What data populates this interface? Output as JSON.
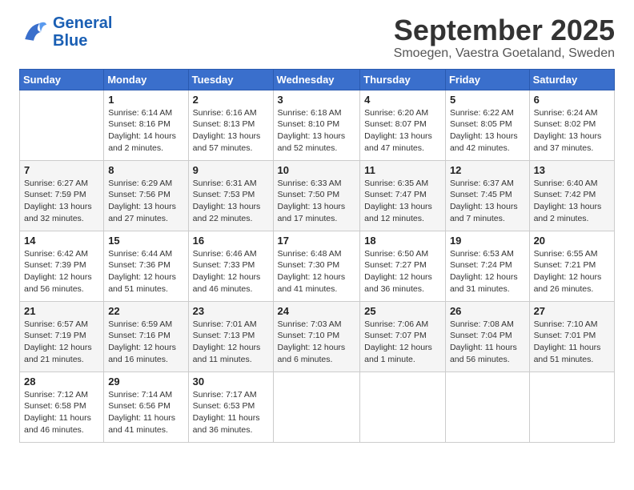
{
  "logo": {
    "line1": "General",
    "line2": "Blue"
  },
  "header": {
    "month": "September 2025",
    "location": "Smoegen, Vaestra Goetaland, Sweden"
  },
  "days_of_week": [
    "Sunday",
    "Monday",
    "Tuesday",
    "Wednesday",
    "Thursday",
    "Friday",
    "Saturday"
  ],
  "weeks": [
    [
      {
        "day": "",
        "info": ""
      },
      {
        "day": "1",
        "info": "Sunrise: 6:14 AM\nSunset: 8:16 PM\nDaylight: 14 hours\nand 2 minutes."
      },
      {
        "day": "2",
        "info": "Sunrise: 6:16 AM\nSunset: 8:13 PM\nDaylight: 13 hours\nand 57 minutes."
      },
      {
        "day": "3",
        "info": "Sunrise: 6:18 AM\nSunset: 8:10 PM\nDaylight: 13 hours\nand 52 minutes."
      },
      {
        "day": "4",
        "info": "Sunrise: 6:20 AM\nSunset: 8:07 PM\nDaylight: 13 hours\nand 47 minutes."
      },
      {
        "day": "5",
        "info": "Sunrise: 6:22 AM\nSunset: 8:05 PM\nDaylight: 13 hours\nand 42 minutes."
      },
      {
        "day": "6",
        "info": "Sunrise: 6:24 AM\nSunset: 8:02 PM\nDaylight: 13 hours\nand 37 minutes."
      }
    ],
    [
      {
        "day": "7",
        "info": "Sunrise: 6:27 AM\nSunset: 7:59 PM\nDaylight: 13 hours\nand 32 minutes."
      },
      {
        "day": "8",
        "info": "Sunrise: 6:29 AM\nSunset: 7:56 PM\nDaylight: 13 hours\nand 27 minutes."
      },
      {
        "day": "9",
        "info": "Sunrise: 6:31 AM\nSunset: 7:53 PM\nDaylight: 13 hours\nand 22 minutes."
      },
      {
        "day": "10",
        "info": "Sunrise: 6:33 AM\nSunset: 7:50 PM\nDaylight: 13 hours\nand 17 minutes."
      },
      {
        "day": "11",
        "info": "Sunrise: 6:35 AM\nSunset: 7:47 PM\nDaylight: 13 hours\nand 12 minutes."
      },
      {
        "day": "12",
        "info": "Sunrise: 6:37 AM\nSunset: 7:45 PM\nDaylight: 13 hours\nand 7 minutes."
      },
      {
        "day": "13",
        "info": "Sunrise: 6:40 AM\nSunset: 7:42 PM\nDaylight: 13 hours\nand 2 minutes."
      }
    ],
    [
      {
        "day": "14",
        "info": "Sunrise: 6:42 AM\nSunset: 7:39 PM\nDaylight: 12 hours\nand 56 minutes."
      },
      {
        "day": "15",
        "info": "Sunrise: 6:44 AM\nSunset: 7:36 PM\nDaylight: 12 hours\nand 51 minutes."
      },
      {
        "day": "16",
        "info": "Sunrise: 6:46 AM\nSunset: 7:33 PM\nDaylight: 12 hours\nand 46 minutes."
      },
      {
        "day": "17",
        "info": "Sunrise: 6:48 AM\nSunset: 7:30 PM\nDaylight: 12 hours\nand 41 minutes."
      },
      {
        "day": "18",
        "info": "Sunrise: 6:50 AM\nSunset: 7:27 PM\nDaylight: 12 hours\nand 36 minutes."
      },
      {
        "day": "19",
        "info": "Sunrise: 6:53 AM\nSunset: 7:24 PM\nDaylight: 12 hours\nand 31 minutes."
      },
      {
        "day": "20",
        "info": "Sunrise: 6:55 AM\nSunset: 7:21 PM\nDaylight: 12 hours\nand 26 minutes."
      }
    ],
    [
      {
        "day": "21",
        "info": "Sunrise: 6:57 AM\nSunset: 7:19 PM\nDaylight: 12 hours\nand 21 minutes."
      },
      {
        "day": "22",
        "info": "Sunrise: 6:59 AM\nSunset: 7:16 PM\nDaylight: 12 hours\nand 16 minutes."
      },
      {
        "day": "23",
        "info": "Sunrise: 7:01 AM\nSunset: 7:13 PM\nDaylight: 12 hours\nand 11 minutes."
      },
      {
        "day": "24",
        "info": "Sunrise: 7:03 AM\nSunset: 7:10 PM\nDaylight: 12 hours\nand 6 minutes."
      },
      {
        "day": "25",
        "info": "Sunrise: 7:06 AM\nSunset: 7:07 PM\nDaylight: 12 hours\nand 1 minute."
      },
      {
        "day": "26",
        "info": "Sunrise: 7:08 AM\nSunset: 7:04 PM\nDaylight: 11 hours\nand 56 minutes."
      },
      {
        "day": "27",
        "info": "Sunrise: 7:10 AM\nSunset: 7:01 PM\nDaylight: 11 hours\nand 51 minutes."
      }
    ],
    [
      {
        "day": "28",
        "info": "Sunrise: 7:12 AM\nSunset: 6:58 PM\nDaylight: 11 hours\nand 46 minutes."
      },
      {
        "day": "29",
        "info": "Sunrise: 7:14 AM\nSunset: 6:56 PM\nDaylight: 11 hours\nand 41 minutes."
      },
      {
        "day": "30",
        "info": "Sunrise: 7:17 AM\nSunset: 6:53 PM\nDaylight: 11 hours\nand 36 minutes."
      },
      {
        "day": "",
        "info": ""
      },
      {
        "day": "",
        "info": ""
      },
      {
        "day": "",
        "info": ""
      },
      {
        "day": "",
        "info": ""
      }
    ]
  ]
}
